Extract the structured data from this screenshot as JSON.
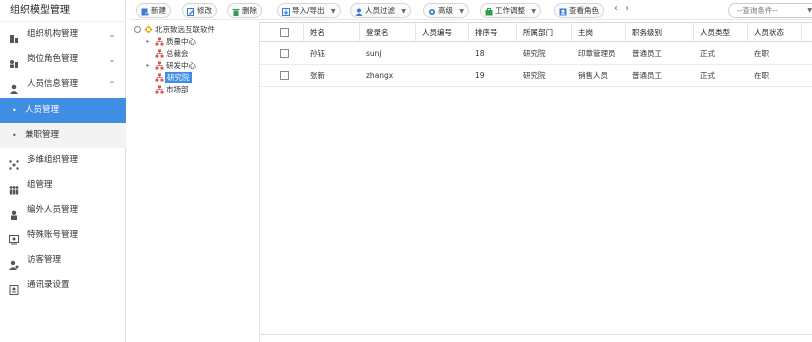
{
  "sidebar": {
    "title": "组织模型管理",
    "items": [
      {
        "label": "组织机构管理",
        "icon": "org-chart-icon",
        "chevron": "⌄"
      },
      {
        "label": "岗位角色管理",
        "icon": "role-icon",
        "chevron": "⌄"
      },
      {
        "label": "人员信息管理",
        "icon": "user-icon",
        "chevron": "⌃"
      },
      {
        "label": "人员管理",
        "sub": true,
        "active": true
      },
      {
        "label": "兼职管理",
        "sub": true
      },
      {
        "label": "多维组织管理",
        "icon": "multi-org-icon"
      },
      {
        "label": "组管理",
        "icon": "group-icon"
      },
      {
        "label": "编外人员管理",
        "icon": "external-user-icon"
      },
      {
        "label": "特殊账号管理",
        "icon": "special-account-icon"
      },
      {
        "label": "访客管理",
        "icon": "visitor-icon"
      },
      {
        "label": "通讯录设置",
        "icon": "contacts-icon"
      }
    ]
  },
  "toolbar": {
    "new": "新建",
    "edit": "修改",
    "delete": "删除",
    "import_export": "导入/导出",
    "person_filter": "人员过滤",
    "advanced": "高级",
    "work_adjust": "工作调整",
    "view_role": "查看角色",
    "nav_arrows": "‹ ›",
    "query_placeholder": "--查询条件--"
  },
  "tree": {
    "root": "北京致远互联软件",
    "nodes": [
      "质量中心",
      "总裁会",
      "研发中心",
      "研究院",
      "市场部"
    ],
    "selected": "研究院"
  },
  "grid": {
    "columns": [
      "姓名",
      "登录名",
      "人员编号",
      "排序号",
      "所属部门",
      "主岗",
      "职务级别",
      "人员类型",
      "人员状态"
    ],
    "rows": [
      [
        "孙钰",
        "sunj",
        "",
        "18",
        "研究院",
        "印章管理员",
        "普通员工",
        "正式",
        "在职"
      ],
      [
        "张新",
        "zhangx",
        "",
        "19",
        "研究院",
        "销售人员",
        "普通员工",
        "正式",
        "在职"
      ]
    ]
  },
  "colors": {
    "accent": "#3f8ee4",
    "icon_blue": "#3a7bd5",
    "icon_green": "#2e9b4f",
    "icon_red": "#d9534f"
  }
}
